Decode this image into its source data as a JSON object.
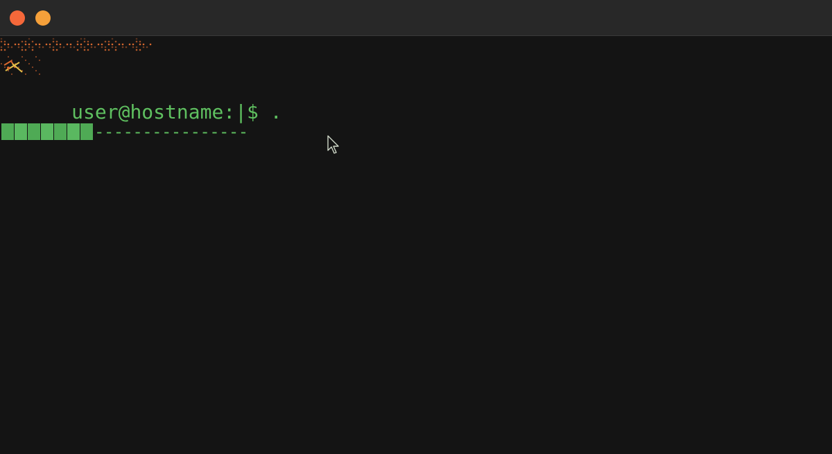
{
  "window": {
    "controls": [
      {
        "name": "close",
        "color": "#f5683a"
      },
      {
        "name": "minimize",
        "color": "#f5a03a"
      }
    ]
  },
  "colors": {
    "background": "#141414",
    "titlebar": "#282828",
    "prompt_green": "#5fc060",
    "banner_orange": "#d8682e",
    "progress_green": "#4faa55"
  },
  "terminal": {
    "prompt_text": "user@hostname:",
    "cursor_bar": "|",
    "command_text": "$ .",
    "progress": {
      "fraction": 0.31,
      "dashes": "----------------"
    }
  },
  "icons": {
    "banner": "ascii-art-banner",
    "pointer": "mouse-pointer-icon"
  }
}
